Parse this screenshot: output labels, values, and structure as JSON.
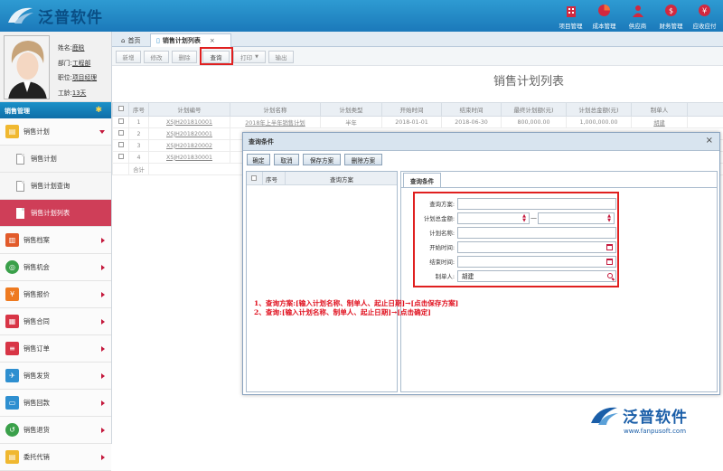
{
  "app": {
    "logo_text": "泛普软件"
  },
  "topnav": [
    {
      "label": "项目管理",
      "icon": "building-icon"
    },
    {
      "label": "成本管理",
      "icon": "pie-icon"
    },
    {
      "label": "供应商",
      "icon": "user-icon"
    },
    {
      "label": "财务管理",
      "icon": "money-icon"
    },
    {
      "label": "应收应付",
      "icon": "coin-icon"
    }
  ],
  "user": {
    "name_label": "姓名:",
    "name": "鹿晗",
    "dept_label": "部门:",
    "dept": "工程部",
    "title_label": "职位:",
    "title": "项目经理",
    "age_label": "工龄:",
    "age": "13天"
  },
  "menu": {
    "header": "销售管理",
    "items": [
      {
        "label": "销售计划",
        "expanded": true
      },
      {
        "label": "销售档案"
      },
      {
        "label": "销售机会"
      },
      {
        "label": "销售报价"
      },
      {
        "label": "销售合同"
      },
      {
        "label": "销售订单"
      },
      {
        "label": "销售发货"
      },
      {
        "label": "销售回款"
      },
      {
        "label": "销售退货"
      },
      {
        "label": "委托代销"
      }
    ],
    "subitems": [
      "销售计划",
      "销售计划查询",
      "销售计划列表"
    ]
  },
  "tabs": {
    "home": "首页",
    "current": "销售计划列表",
    "close": "×"
  },
  "toolbar": {
    "add": "新增",
    "edit": "修改",
    "delete": "删除",
    "query": "查询",
    "print": "打印",
    "export": "输出"
  },
  "page_title": "销售计划列表",
  "table": {
    "columns": [
      "序号",
      "计划编号",
      "计划名称",
      "计划类型",
      "开始时间",
      "结束时间",
      "最终计划额(元)",
      "计划总金额(元)",
      "制单人"
    ],
    "rows": [
      [
        "1",
        "XSJH201810001",
        "2018年上半年销售计划",
        "半年",
        "2018-01-01",
        "2018-06-30",
        "800,000.00",
        "1,000,000.00",
        "胡建"
      ],
      [
        "2",
        "XSJH201820001",
        "",
        "",
        "",
        "",
        "",
        "",
        ""
      ],
      [
        "3",
        "XSJH201820002",
        "",
        "",
        "",
        "",
        "",
        "",
        ""
      ],
      [
        "4",
        "XSJH201830001",
        "",
        "",
        "",
        "",
        "",
        "",
        ""
      ]
    ],
    "footer": "合计"
  },
  "dialog": {
    "title": "查询条件",
    "close": "×",
    "buttons": {
      "confirm": "确定",
      "cancel": "取消",
      "save": "保存方案",
      "delete": "删除方案"
    },
    "list_cols": {
      "seq": "序号",
      "plan": "查询方案"
    },
    "tab": "查询条件",
    "form": {
      "scheme_label": "查询方案:",
      "total_label": "计划总金额:",
      "range_sep": "—",
      "name_label": "计划名称:",
      "start_label": "开始时间:",
      "end_label": "结束时间:",
      "maker_label": "制单人:",
      "maker_value": "胡建"
    }
  },
  "note": {
    "line1": "1、查询方案:[输入计划名称、制单人、起止日期]→[点击保存方案]",
    "line2": "2、查询:[输入计划名称、制单人、起止日期]→[点击确定]"
  },
  "brand": {
    "name": "泛普软件",
    "url": "www.fanpusoft.com"
  },
  "colors": {
    "accent": "#c4183c",
    "header_blue": "#1b79ba",
    "highlight": "#e02020"
  }
}
